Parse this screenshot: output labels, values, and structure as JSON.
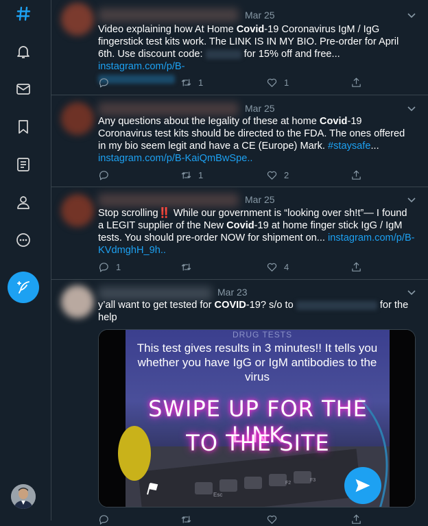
{
  "tweets": [
    {
      "date": "Mar 25",
      "text_pre": "Video explaining how At Home ",
      "text_bold": "Covid",
      "text_post": "-19 Coronavirus IgM / IgG fingerstick test kits work. The LINK IS IN MY BIO. Pre-order for April 6th. Use discount code: ",
      "text_post2": " for 15% off and free... ",
      "link": "instagram.com/p/B-",
      "retweets": "1",
      "likes": "1"
    },
    {
      "date": "Mar 25",
      "text_pre": "Any questions about the legality of these at home ",
      "text_bold": "Covid",
      "text_post": "-19 Coronavirus test kits should be directed to the FDA. The ones offered in my bio seem legit and have a CE (Europe) Mark. ",
      "hashtag": "#staysafe",
      "text_post2": "... ",
      "link": "instagram.com/p/B-KaiQmBwSpe..",
      "retweets": "1",
      "likes": "2"
    },
    {
      "date": "Mar 25",
      "text_pre": "Stop scrolling",
      "emoji": "‼️",
      "text_mid": " While our government is “looking over sh!t”— I found a LEGIT supplier of the New ",
      "text_bold": "Covid",
      "text_post": "-19 at home finger stick IgG / IgM tests. You should pre-order NOW for  shipment on... ",
      "link": "instagram.com/p/B-KVdmghH_9h..",
      "replies": "1",
      "likes": "4"
    },
    {
      "date": "Mar 23",
      "text_pre": "y’all want to get tested for ",
      "text_bold": "COVID",
      "text_post": "-19? s/o to ",
      "text_post2": " for the help",
      "media": {
        "sign": "DRUG TESTS",
        "caption": "This test gives results in 3 minutes!!  It tells you whether you have IgG or IgM antibodies to the virus",
        "neon_line1": "SWIPE UP FOR THE LINK",
        "neon_line2": "TO THE SITE",
        "key_esc": "Esc",
        "key_f2": "F2",
        "key_f3": "F3"
      }
    }
  ],
  "icons": [
    "hashtag-icon",
    "bell-icon",
    "mail-icon",
    "bookmark-icon",
    "list-icon",
    "profile-icon",
    "more-icon",
    "compose-icon"
  ],
  "colors": {
    "background": "#15202b",
    "accent": "#1da1f2",
    "muted": "#8899a6",
    "border": "#38444d"
  }
}
